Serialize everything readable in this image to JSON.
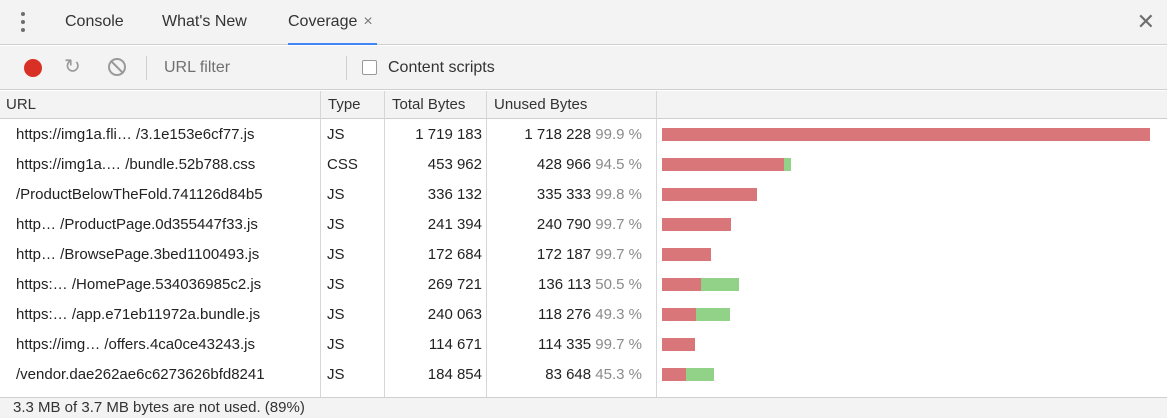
{
  "tabs": {
    "items": [
      {
        "label": "Console"
      },
      {
        "label": "What's New"
      },
      {
        "label": "Coverage",
        "close": "×"
      }
    ],
    "active": "Coverage",
    "panel_close": "✕"
  },
  "toolbar": {
    "record_state": "recording",
    "url_filter_placeholder": "URL filter",
    "content_scripts_label": "Content scripts",
    "content_scripts_checked": false
  },
  "table": {
    "columns": [
      "URL",
      "Type",
      "Total Bytes",
      "Unused Bytes"
    ],
    "rows": [
      {
        "url": "https://img1a.fli…  /3.1e153e6cf77.js",
        "type": "JS",
        "total": "1 719 183",
        "unused": "1 718 228",
        "pct": "99.9 %",
        "total_bytes": 1719183,
        "unused_bytes": 1718228
      },
      {
        "url": "https://img1a.…  /bundle.52b788.css",
        "type": "CSS",
        "total": "453 962",
        "unused": "428 966",
        "pct": "94.5 %",
        "total_bytes": 453962,
        "unused_bytes": 428966
      },
      {
        "url": "/ProductBelowTheFold.741126d84b5",
        "type": "JS",
        "total": "336 132",
        "unused": "335 333",
        "pct": "99.8 %",
        "total_bytes": 336132,
        "unused_bytes": 335333
      },
      {
        "url": "http…  /ProductPage.0d355447f33.js",
        "type": "JS",
        "total": "241 394",
        "unused": "240 790",
        "pct": "99.7 %",
        "total_bytes": 241394,
        "unused_bytes": 240790
      },
      {
        "url": "http…  /BrowsePage.3bed1100493.js",
        "type": "JS",
        "total": "172 684",
        "unused": "172 187",
        "pct": "99.7 %",
        "total_bytes": 172684,
        "unused_bytes": 172187
      },
      {
        "url": "https:…  /HomePage.534036985c2.js",
        "type": "JS",
        "total": "269 721",
        "unused": "136 113",
        "pct": "50.5 %",
        "total_bytes": 269721,
        "unused_bytes": 136113
      },
      {
        "url": "https:…  /app.e71eb11972a.bundle.js",
        "type": "JS",
        "total": "240 063",
        "unused": "118 276",
        "pct": "49.3 %",
        "total_bytes": 240063,
        "unused_bytes": 118276
      },
      {
        "url": "https://img…  /offers.4ca0ce43243.js",
        "type": "JS",
        "total": "114 671",
        "unused": "114 335",
        "pct": "99.7 %",
        "total_bytes": 114671,
        "unused_bytes": 114335
      },
      {
        "url": "/vendor.dae262ae6c6273626bfd8241",
        "type": "JS",
        "total": "184 854",
        "unused": "83 648",
        "pct": "45.3 %",
        "total_bytes": 184854,
        "unused_bytes": 83648
      }
    ]
  },
  "colors": {
    "unused_bar": "#d9767a",
    "used_bar": "#91d188",
    "record": "#d93025",
    "active_tab_underline": "#4285f4"
  },
  "status": {
    "text": "3.3 MB of 3.7 MB bytes are not used. (89%)"
  }
}
